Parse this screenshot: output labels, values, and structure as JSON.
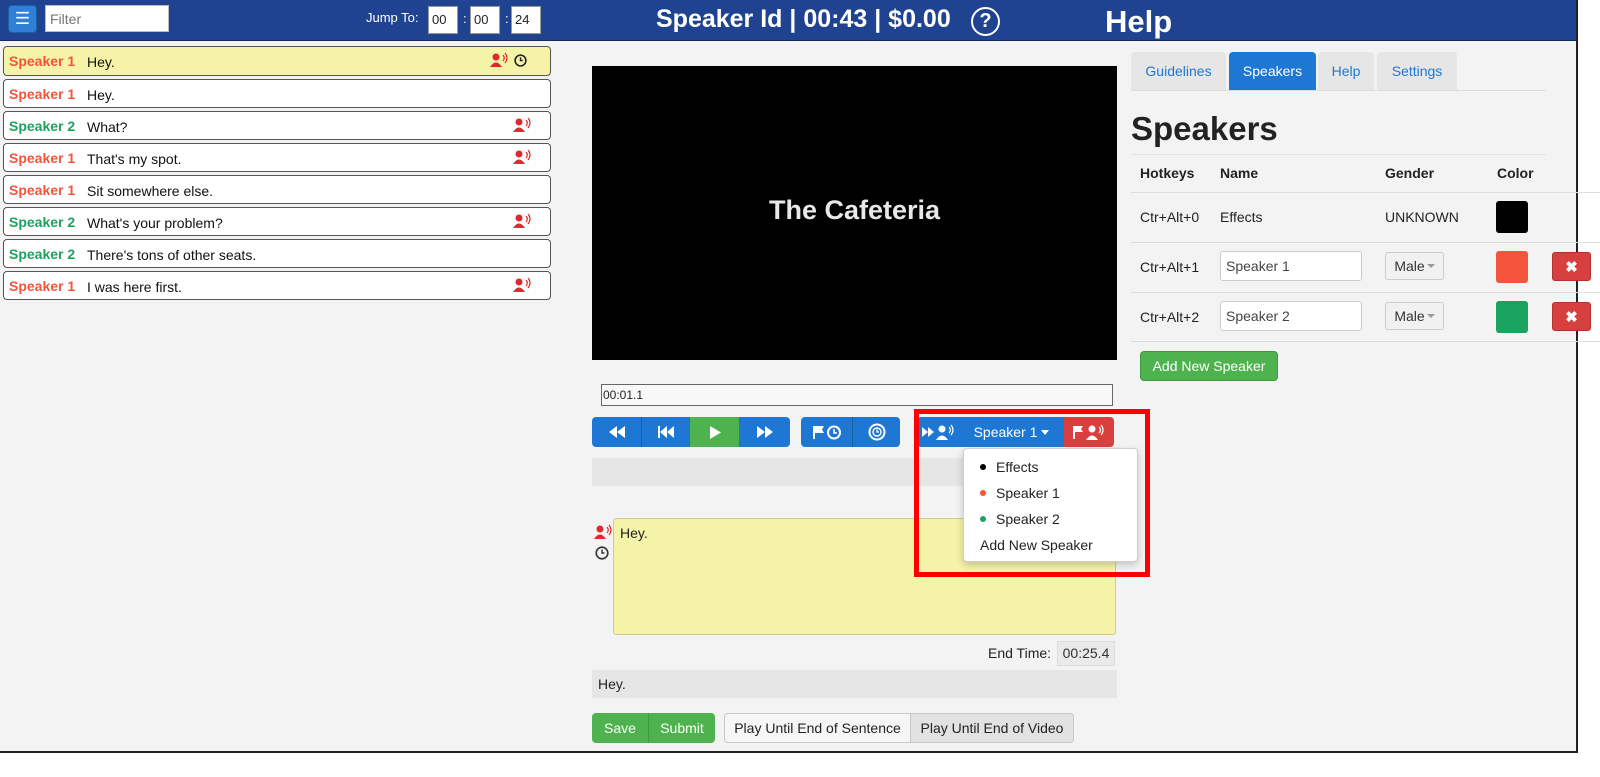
{
  "topbar": {
    "filter_placeholder": "Filter",
    "jump_label": "Jump To:",
    "jump_hours": "00",
    "jump_minutes": "00",
    "jump_seconds": "24",
    "sep": ":",
    "title": "Speaker Id | 00:43 | $0.00",
    "help_circle": "?",
    "help": "Help"
  },
  "colors": {
    "effects": "#000000",
    "speaker1": "#f4543b",
    "speaker2": "#1aa35e",
    "primary": "#1e77d2",
    "success": "#4eb24e",
    "danger": "#d8403f",
    "highlight": "#ff0000"
  },
  "transcript": [
    {
      "speaker": "Speaker 1",
      "text": "Hey.",
      "color": "#f4543b",
      "active": true,
      "speaker_icon": true,
      "clock_icon": true
    },
    {
      "speaker": "Speaker 1",
      "text": "Hey.",
      "color": "#f4543b",
      "active": false,
      "speaker_icon": false,
      "clock_icon": false
    },
    {
      "speaker": "Speaker 2",
      "text": "What?",
      "color": "#1aa35e",
      "active": false,
      "speaker_icon": true,
      "clock_icon": false
    },
    {
      "speaker": "Speaker 1",
      "text": "That's my spot.",
      "color": "#f4543b",
      "active": false,
      "speaker_icon": true,
      "clock_icon": false
    },
    {
      "speaker": "Speaker 1",
      "text": "Sit somewhere else.",
      "color": "#f4543b",
      "active": false,
      "speaker_icon": false,
      "clock_icon": false
    },
    {
      "speaker": "Speaker 2",
      "text": "What's your problem?",
      "color": "#1aa35e",
      "active": false,
      "speaker_icon": true,
      "clock_icon": false
    },
    {
      "speaker": "Speaker 2",
      "text": "There's tons of other seats.",
      "color": "#1aa35e",
      "active": false,
      "speaker_icon": false,
      "clock_icon": false
    },
    {
      "speaker": "Speaker 1",
      "text": "I was here first.",
      "color": "#f4543b",
      "active": false,
      "speaker_icon": true,
      "clock_icon": false
    }
  ],
  "video": {
    "title_text": "The Cafeteria",
    "current_time": "00:01.1"
  },
  "controls": {
    "current_speaker": "Speaker 1",
    "dropdown": [
      {
        "label": "Effects",
        "color": "#000000"
      },
      {
        "label": "Speaker 1",
        "color": "#f4543b"
      },
      {
        "label": "Speaker 2",
        "color": "#1aa35e"
      },
      {
        "label": "Add New Speaker",
        "color": ""
      }
    ]
  },
  "editor": {
    "text": "Hey.",
    "end_time_label": "End Time:",
    "end_time_value": "00:25.4",
    "preview": "Hey.",
    "save": "Save",
    "submit": "Submit",
    "play_sentence": "Play Until End of Sentence",
    "play_video": "Play Until End of Video"
  },
  "panel": {
    "tabs": [
      "Guidelines",
      "Speakers",
      "Help",
      "Settings"
    ],
    "active_tab": "Speakers",
    "heading": "Speakers",
    "columns": [
      "Hotkeys",
      "Name",
      "Gender",
      "Color"
    ],
    "rows": [
      {
        "hotkey": "Ctr+Alt+0",
        "name": "Effects",
        "editable": false,
        "gender": "UNKNOWN",
        "color": "#000000",
        "deletable": false
      },
      {
        "hotkey": "Ctr+Alt+1",
        "name": "Speaker 1",
        "editable": true,
        "gender": "Male",
        "color": "#f4543b",
        "deletable": true
      },
      {
        "hotkey": "Ctr+Alt+2",
        "name": "Speaker 2",
        "editable": true,
        "gender": "Male",
        "color": "#1aa35e",
        "deletable": true
      }
    ],
    "add_button": "Add New Speaker"
  }
}
